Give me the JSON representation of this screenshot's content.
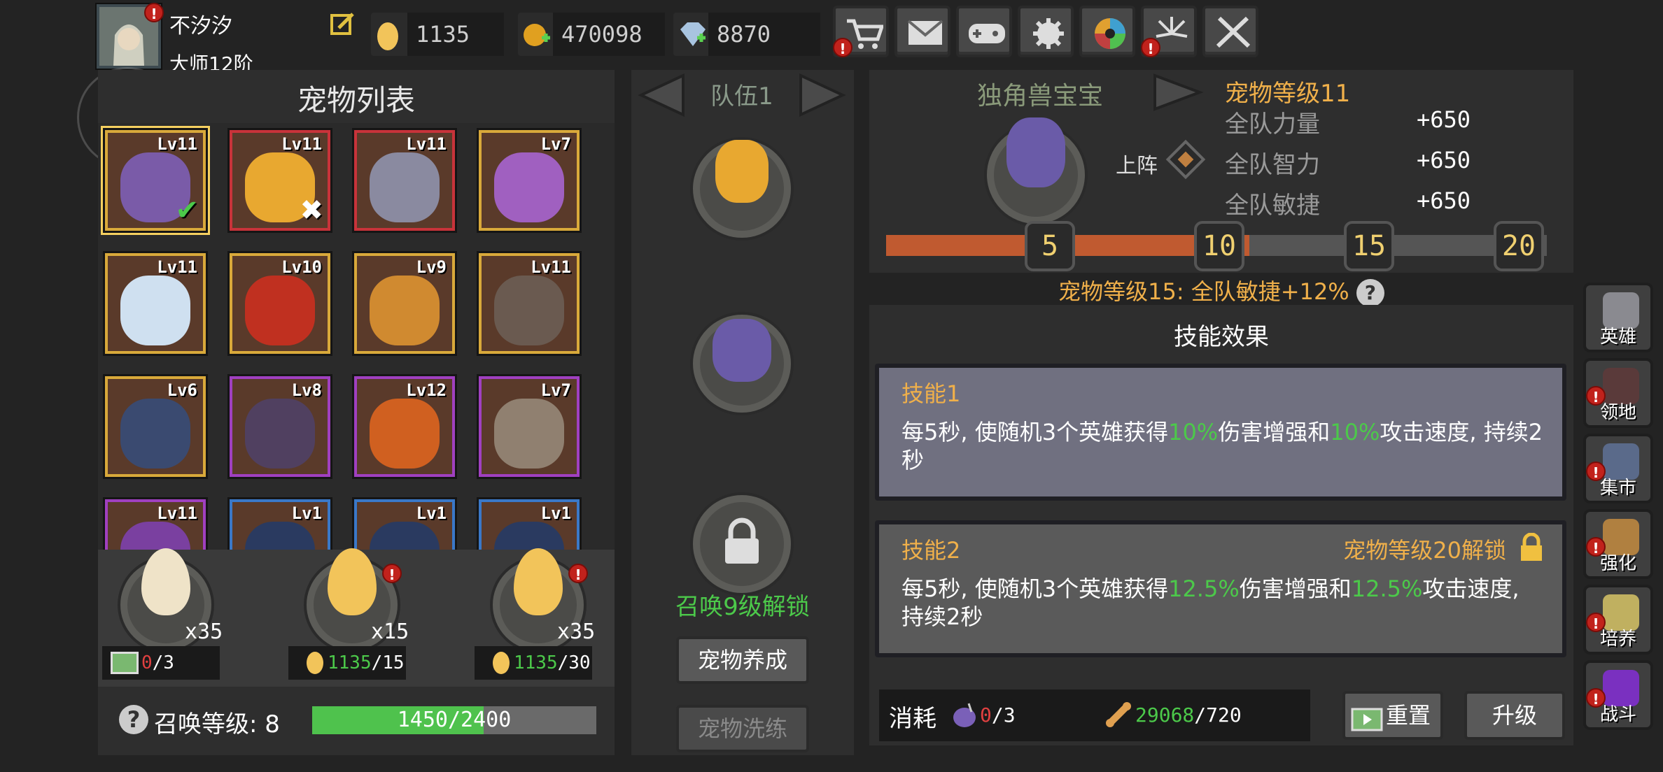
{
  "player": {
    "name": "不汐汐",
    "rank": "大师12阶",
    "badge": "!"
  },
  "resources": {
    "eggs": "1135",
    "gold": "470098",
    "gems": "8870"
  },
  "top_buttons": [
    "shop",
    "mail",
    "controller",
    "settings",
    "color-wheel",
    "fireworks",
    "swords"
  ],
  "pet_list": {
    "title": "宠物列表",
    "pets": [
      {
        "level": "Lv11",
        "color": "#d9a93a",
        "art": "#7a5ba8"
      },
      {
        "level": "Lv11",
        "color": "#c8333a",
        "art": "#e8a830"
      },
      {
        "level": "Lv11",
        "color": "#c8333a",
        "art": "#8a8aa0"
      },
      {
        "level": "Lv7",
        "color": "#d9a93a",
        "art": "#a060c0"
      },
      {
        "level": "Lv11",
        "color": "#d9a93a",
        "art": "#cfe0f0"
      },
      {
        "level": "Lv10",
        "color": "#d9a93a",
        "art": "#c03020"
      },
      {
        "level": "Lv9",
        "color": "#d9a93a",
        "art": "#d08a30"
      },
      {
        "level": "Lv11",
        "color": "#d9a93a",
        "art": "#6a5a50"
      },
      {
        "level": "Lv6",
        "color": "#d9a93a",
        "art": "#3a4a70"
      },
      {
        "level": "Lv8",
        "color": "#a040c0",
        "art": "#504060"
      },
      {
        "level": "Lv12",
        "color": "#a040c0",
        "art": "#d06020"
      },
      {
        "level": "Lv7",
        "color": "#a040c0",
        "art": "#908070"
      },
      {
        "level": "Lv11",
        "color": "#a040c0",
        "art": "#7a40a0"
      },
      {
        "level": "Lv1",
        "color": "#3a78c8",
        "art": "#2a3a60"
      },
      {
        "level": "Lv1",
        "color": "#3a78c8",
        "art": "#2a3a60"
      },
      {
        "level": "Lv1",
        "color": "#3a78c8",
        "art": "#2a3a60"
      }
    ]
  },
  "summon": {
    "eggs": [
      {
        "count": "x35",
        "cost_current": "0",
        "cost_total": "/3",
        "cost_type": "ad",
        "color": "#efe3c8"
      },
      {
        "count": "x15",
        "cost_current": "1135",
        "cost_total": "/15",
        "cost_type": "egg",
        "color": "#f2c45a"
      },
      {
        "count": "x35",
        "cost_current": "1135",
        "cost_total": "/30",
        "cost_type": "egg",
        "color": "#f2c45a"
      }
    ],
    "level_label": "召唤等级: 8",
    "progress_text": "1450/2400",
    "progress_fraction": 0.604
  },
  "team": {
    "title": "队伍1",
    "locked_text": "召唤9级解锁",
    "btn_cultivate": "宠物养成",
    "btn_wash": "宠物洗练"
  },
  "detail": {
    "pet_name": "独角兽宝宝",
    "pet_level": "宠物等级11",
    "deploy": "上阵",
    "stats": [
      {
        "label": "全队力量",
        "value": "+650"
      },
      {
        "label": "全队智力",
        "value": "+650"
      },
      {
        "label": "全队敏捷",
        "value": "+650"
      }
    ],
    "milestones": [
      "5",
      "10",
      "15",
      "20"
    ],
    "milestone_progress": 0.55,
    "bonus_text": "宠物等级15: 全队敏捷+12%",
    "skills_title": "技能效果",
    "skill1": {
      "title": "技能1",
      "pre": "每5秒, 使随机3个英雄获得",
      "v1": "10%",
      "mid": "伤害增强和",
      "v2": "10%",
      "post": "攻击速度, 持续2秒"
    },
    "skill2": {
      "title": "技能2",
      "unlock": "宠物等级20解锁",
      "pre": "每5秒, 使随机3个英雄获得",
      "v1": "12.5%",
      "mid": "伤害增强和",
      "v2": "12.5%",
      "post": "攻击速度, 持续2秒"
    },
    "cost_label": "消耗",
    "cost1_current": "0",
    "cost1_total": "/3",
    "cost2_current": "29068",
    "cost2_total": "/720",
    "btn_reset": "重置",
    "btn_upgrade": "升级"
  },
  "side_menu": [
    "英雄",
    "领地",
    "集市",
    "强化",
    "培养",
    "战斗"
  ]
}
